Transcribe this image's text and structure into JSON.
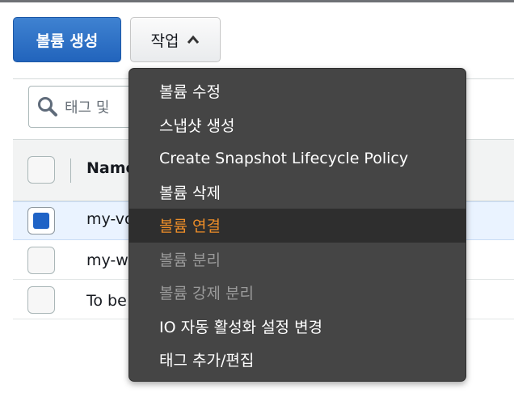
{
  "toolbar": {
    "create_label": "볼륨 생성",
    "actions_label": "작업"
  },
  "search": {
    "placeholder": "태그 및"
  },
  "table": {
    "header_name": "Name",
    "rows": [
      {
        "name": "my-vo",
        "selected": true
      },
      {
        "name": "my-w",
        "selected": false
      },
      {
        "name": "To be",
        "selected": false
      }
    ]
  },
  "menu": {
    "items": [
      {
        "label": "볼륨 수정",
        "state": "enabled"
      },
      {
        "label": "스냅샷 생성",
        "state": "enabled"
      },
      {
        "label": "Create Snapshot Lifecycle Policy",
        "state": "enabled"
      },
      {
        "label": "볼륨 삭제",
        "state": "enabled"
      },
      {
        "label": "볼륨 연결",
        "state": "highlighted"
      },
      {
        "label": "볼륨 분리",
        "state": "disabled"
      },
      {
        "label": "볼륨 강제 분리",
        "state": "disabled"
      },
      {
        "label": "IO 자동 활성화 설정 변경",
        "state": "enabled"
      },
      {
        "label": "태그 추가/편집",
        "state": "enabled"
      }
    ]
  },
  "colors": {
    "primary": "#2264bc",
    "highlight_text": "#ec8d28",
    "menu_bg": "#454545"
  },
  "icons": {
    "search": "magnifier-icon",
    "actions_chevron": "chevron-up-icon"
  }
}
